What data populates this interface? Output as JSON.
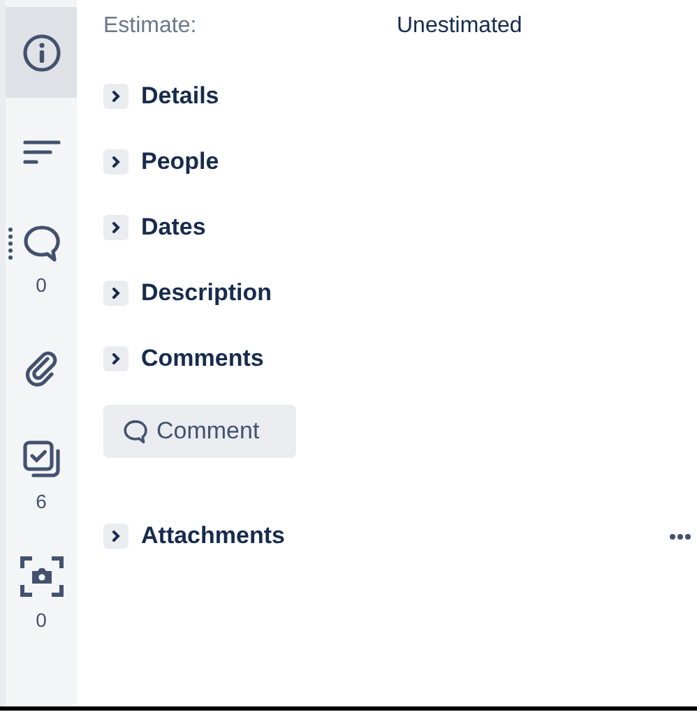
{
  "sidebar": {
    "items": [
      {
        "kind": "info",
        "selected": true
      },
      {
        "kind": "sort",
        "selected": false
      },
      {
        "kind": "comments",
        "selected": false,
        "count": "0"
      },
      {
        "kind": "attachments",
        "selected": false
      },
      {
        "kind": "checklist",
        "selected": false,
        "count": "6"
      },
      {
        "kind": "screenshot",
        "selected": false,
        "count": "0"
      }
    ]
  },
  "estimate": {
    "label": "Estimate:",
    "value": "Unestimated"
  },
  "sections": [
    {
      "title": "Details",
      "expanded": false
    },
    {
      "title": "People",
      "expanded": false
    },
    {
      "title": "Dates",
      "expanded": false
    },
    {
      "title": "Description",
      "expanded": false
    },
    {
      "title": "Comments",
      "expanded": false
    }
  ],
  "comment_button": {
    "label": "Comment"
  },
  "attachments": {
    "title": "Attachments",
    "expanded": false
  }
}
